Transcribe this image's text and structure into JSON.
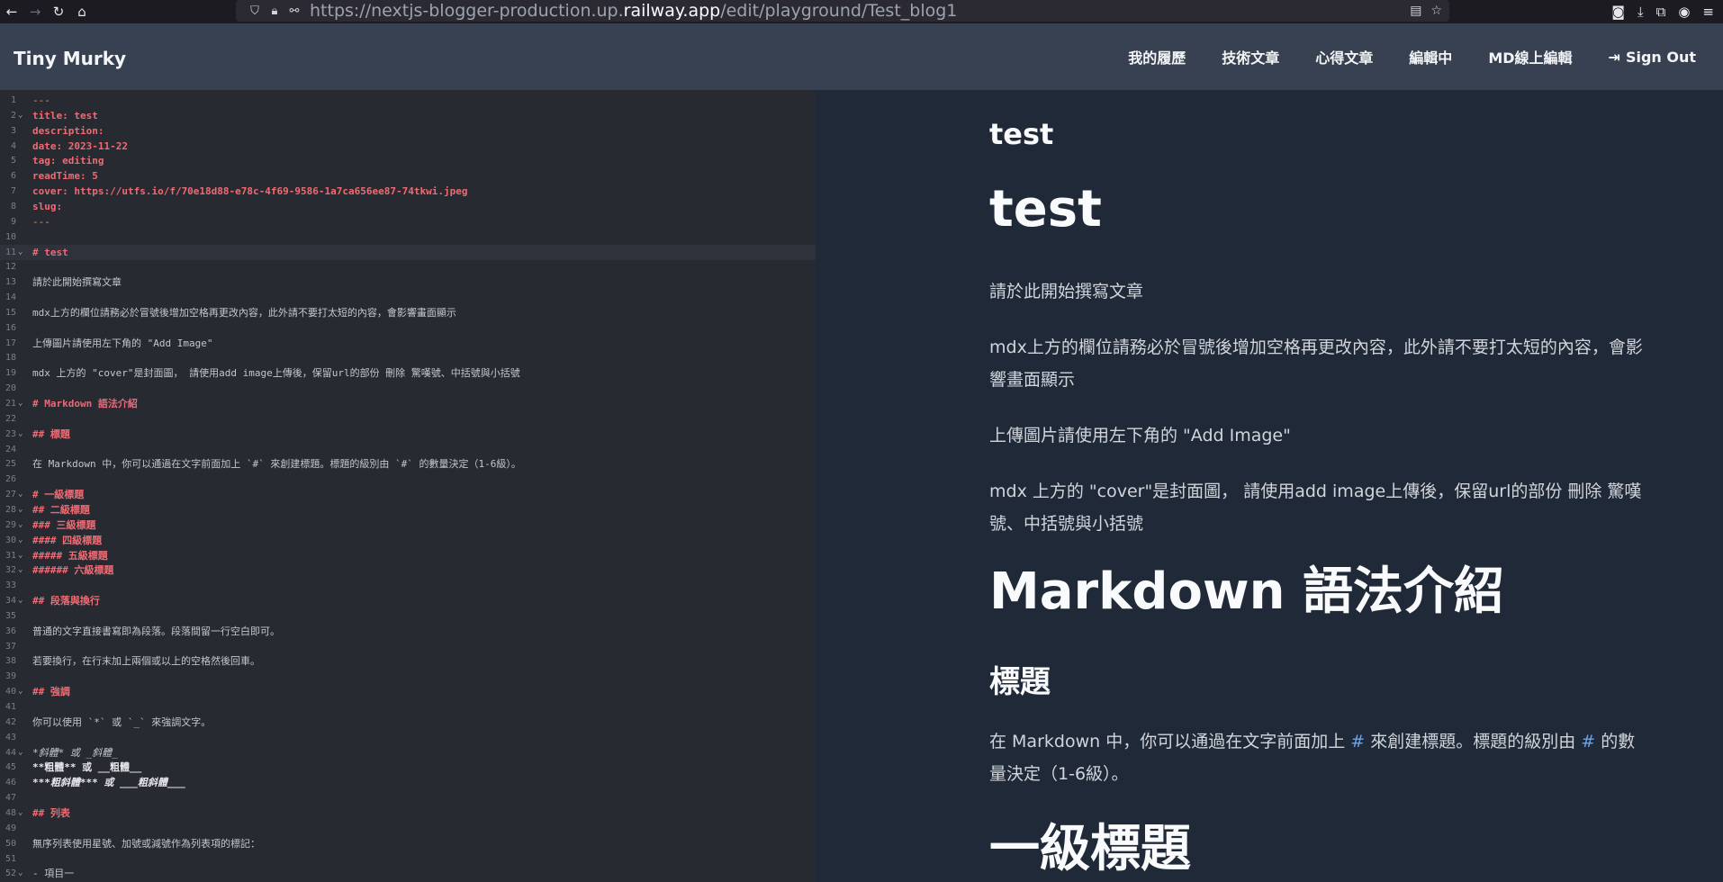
{
  "browser": {
    "url_prefix": "https://nextjs-blogger-production.up.",
    "url_host": "railway.app",
    "url_path": "/edit/playground/Test_blog1"
  },
  "navbar": {
    "brand": "Tiny Murky",
    "links": [
      "我的履歷",
      "技術文章",
      "心得文章",
      "編輯中",
      "MD線上編輯"
    ],
    "sign_out": "Sign Out"
  },
  "editor": {
    "lines": [
      {
        "n": "1",
        "fold": "",
        "text": "---",
        "style": "c-dash"
      },
      {
        "n": "2",
        "fold": "⌄",
        "text": "title: test",
        "style": "c-meta"
      },
      {
        "n": "3",
        "fold": "",
        "text": "description:",
        "style": "c-meta"
      },
      {
        "n": "4",
        "fold": "",
        "text": "date: 2023-11-22",
        "style": "c-meta"
      },
      {
        "n": "5",
        "fold": "",
        "text": "tag: editing",
        "style": "c-meta"
      },
      {
        "n": "6",
        "fold": "",
        "text": "readTime: 5",
        "style": "c-meta"
      },
      {
        "n": "7",
        "fold": "",
        "text": "cover: https://utfs.io/f/70e18d88-e78c-4f69-9586-1a7ca656ee87-74tkwi.jpeg",
        "style": "c-meta"
      },
      {
        "n": "8",
        "fold": "",
        "text": "slug:",
        "style": "c-meta"
      },
      {
        "n": "9",
        "fold": "",
        "text": "---",
        "style": "c-dash"
      },
      {
        "n": "10",
        "fold": "",
        "text": "",
        "style": "c-text"
      },
      {
        "n": "11",
        "fold": "⌄",
        "text": "# test",
        "style": "c-h1"
      },
      {
        "n": "12",
        "fold": "",
        "text": "",
        "style": "c-text"
      },
      {
        "n": "13",
        "fold": "",
        "text": "請於此開始撰寫文章",
        "style": "c-text"
      },
      {
        "n": "14",
        "fold": "",
        "text": "",
        "style": "c-text"
      },
      {
        "n": "15",
        "fold": "",
        "text": "mdx上方的欄位請務必於冒號後增加空格再更改內容，此外請不要打太短的內容，會影響畫面顯示",
        "style": "c-text"
      },
      {
        "n": "16",
        "fold": "",
        "text": "",
        "style": "c-text"
      },
      {
        "n": "17",
        "fold": "",
        "text": "上傳圖片請使用左下角的 \"Add Image\"",
        "style": "c-text"
      },
      {
        "n": "18",
        "fold": "",
        "text": "",
        "style": "c-text"
      },
      {
        "n": "19",
        "fold": "",
        "text": "mdx 上方的 \"cover\"是封面圖， 請使用add image上傳後，保留url的部份 刪除 驚嘆號、中括號與小括號",
        "style": "c-text"
      },
      {
        "n": "20",
        "fold": "",
        "text": "",
        "style": "c-text"
      },
      {
        "n": "21",
        "fold": "⌄",
        "text": "# Markdown 語法介紹",
        "style": "c-h1"
      },
      {
        "n": "22",
        "fold": "",
        "text": "",
        "style": "c-text"
      },
      {
        "n": "23",
        "fold": "⌄",
        "text": "## 標題",
        "style": "c-h"
      },
      {
        "n": "24",
        "fold": "",
        "text": "",
        "style": "c-text"
      },
      {
        "n": "25",
        "fold": "",
        "text": "在 Markdown 中，你可以通過在文字前面加上 `#` 來創建標題。標題的級別由 `#` 的數量決定（1-6級）。",
        "style": "c-text"
      },
      {
        "n": "26",
        "fold": "",
        "text": "",
        "style": "c-text"
      },
      {
        "n": "27",
        "fold": "⌄",
        "text": "# 一級標題",
        "style": "c-h"
      },
      {
        "n": "28",
        "fold": "⌄",
        "text": "## 二級標題",
        "style": "c-h"
      },
      {
        "n": "29",
        "fold": "⌄",
        "text": "### 三級標題",
        "style": "c-h"
      },
      {
        "n": "30",
        "fold": "⌄",
        "text": "#### 四級標題",
        "style": "c-h"
      },
      {
        "n": "31",
        "fold": "⌄",
        "text": "##### 五級標題",
        "style": "c-h"
      },
      {
        "n": "32",
        "fold": "⌄",
        "text": "###### 六級標題",
        "style": "c-h"
      },
      {
        "n": "33",
        "fold": "",
        "text": "",
        "style": "c-text"
      },
      {
        "n": "34",
        "fold": "⌄",
        "text": "## 段落與換行",
        "style": "c-h"
      },
      {
        "n": "35",
        "fold": "",
        "text": "",
        "style": "c-text"
      },
      {
        "n": "36",
        "fold": "",
        "text": "普通的文字直接書寫即為段落。段落間留一行空白即可。",
        "style": "c-text"
      },
      {
        "n": "37",
        "fold": "",
        "text": "",
        "style": "c-text"
      },
      {
        "n": "38",
        "fold": "",
        "text": "若要換行，在行末加上兩個或以上的空格然後回車。",
        "style": "c-text"
      },
      {
        "n": "39",
        "fold": "",
        "text": "",
        "style": "c-text"
      },
      {
        "n": "40",
        "fold": "⌄",
        "text": "## 強調",
        "style": "c-h"
      },
      {
        "n": "41",
        "fold": "",
        "text": "",
        "style": "c-text"
      },
      {
        "n": "42",
        "fold": "",
        "text": "你可以使用 `*` 或 `_` 來強調文字。",
        "style": "c-text"
      },
      {
        "n": "43",
        "fold": "",
        "text": "",
        "style": "c-text"
      },
      {
        "n": "44",
        "fold": "⌄",
        "text": "*斜體* 或 _斜體_",
        "style": "c-it"
      },
      {
        "n": "45",
        "fold": "",
        "text": "**粗體** 或 __粗體__",
        "style": "c-bold"
      },
      {
        "n": "46",
        "fold": "",
        "text": "***粗斜體*** 或 ___粗斜體___",
        "style": "c-bi"
      },
      {
        "n": "47",
        "fold": "",
        "text": "",
        "style": "c-text"
      },
      {
        "n": "48",
        "fold": "⌄",
        "text": "## 列表",
        "style": "c-h"
      },
      {
        "n": "49",
        "fold": "",
        "text": "",
        "style": "c-text"
      },
      {
        "n": "50",
        "fold": "",
        "text": "無序列表使用星號、加號或減號作為列表項的標記：",
        "style": "c-text"
      },
      {
        "n": "51",
        "fold": "",
        "text": "",
        "style": "c-text"
      },
      {
        "n": "52",
        "fold": "⌄",
        "text": "- 項目一",
        "style": "c-list"
      }
    ],
    "active_line": "11"
  },
  "preview": {
    "title_small": "test",
    "title_large": "test",
    "p1": "請於此開始撰寫文章",
    "p2": "mdx上方的欄位請務必於冒號後增加空格再更改內容，此外請不要打太短的內容，會影響畫面顯示",
    "p3": "上傳圖片請使用左下角的 \"Add Image\"",
    "p4": "mdx 上方的 \"cover\"是封面圖， 請使用add image上傳後，保留url的部份 刪除 驚嘆號、中括號與小括號",
    "h1_markdown": "Markdown 語法介紹",
    "h2_title": "標題",
    "p5_a": "在 Markdown 中，你可以通過在文字前面加上 ",
    "p5_hash": "#",
    "p5_b": " 來創建標題。標題的級別由 ",
    "p5_c": " 的數量決定（1-6級）。",
    "h1_level1": "一級標題"
  }
}
